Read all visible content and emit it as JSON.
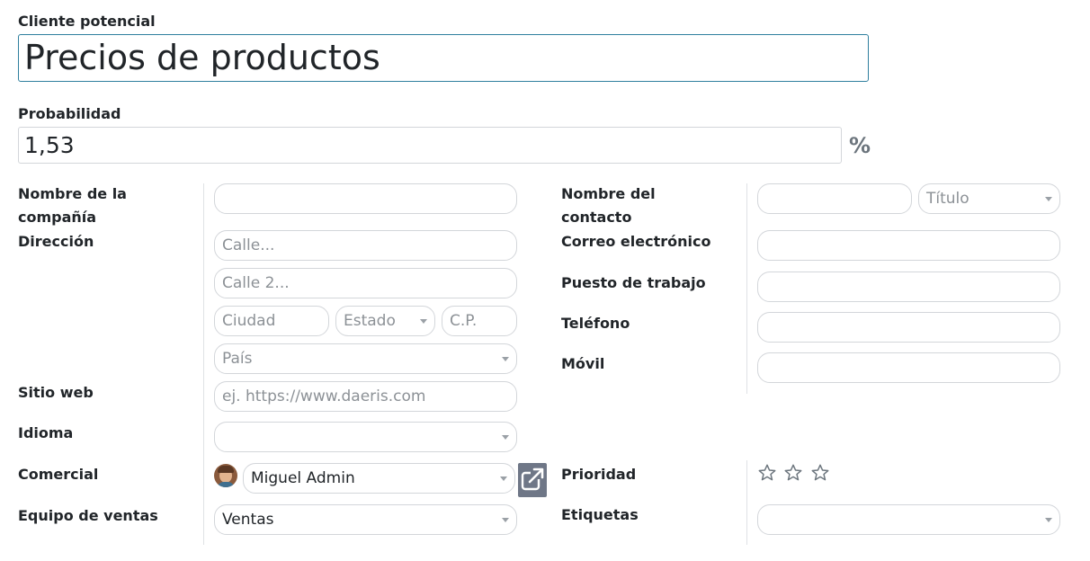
{
  "lead": {
    "label": "Cliente potencial",
    "value": "Precios de productos"
  },
  "probability": {
    "label": "Probabilidad",
    "value": "1,53",
    "unit": "%"
  },
  "company": {
    "name_label": "Nombre de la compañía",
    "address_label": "Dirección",
    "street_placeholder": "Calle...",
    "street2_placeholder": "Calle 2...",
    "city_placeholder": "Ciudad",
    "state_placeholder": "Estado",
    "zip_placeholder": "C.P.",
    "country_placeholder": "País",
    "website_label": "Sitio web",
    "website_placeholder": "ej. https://www.daeris.com",
    "language_label": "Idioma",
    "salesperson_label": "Comercial",
    "salesperson_value": "Miguel Admin",
    "team_label": "Equipo de ventas",
    "team_value": "Ventas"
  },
  "contact": {
    "name_label": "Nombre del contacto",
    "title_placeholder": "Título",
    "email_label": "Correo electrónico",
    "job_label": "Puesto de trabajo",
    "phone_label": "Teléfono",
    "mobile_label": "Móvil",
    "priority_label": "Prioridad",
    "priority_stars": 0,
    "priority_max": 3,
    "tags_label": "Etiquetas"
  },
  "icons": {
    "external": "external-link-icon",
    "star": "star-outline-icon",
    "caret": "chevron-down-icon"
  },
  "colors": {
    "focus_border": "#2f7f9e",
    "external_button": "#6f7787"
  }
}
